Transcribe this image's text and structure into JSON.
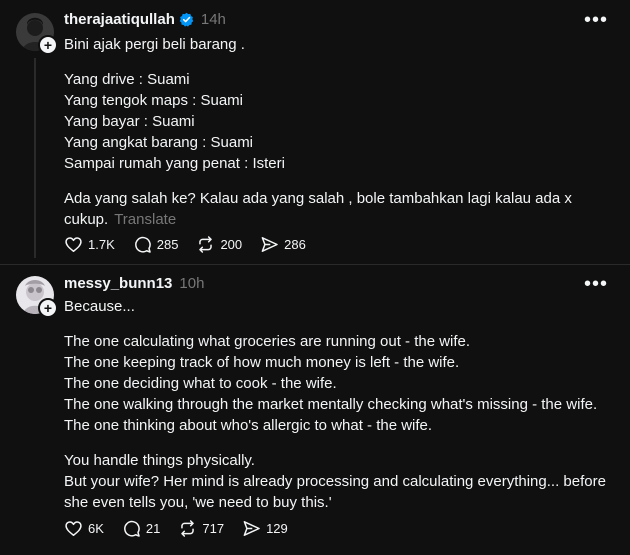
{
  "posts": [
    {
      "username": "therajaatiqullah",
      "verified": true,
      "time": "14h",
      "lines": {
        "l1": "Bini ajak pergi beli barang .",
        "l2": "Yang drive : Suami",
        "l3": "Yang tengok maps : Suami",
        "l4": "Yang bayar : Suami",
        "l5": "Yang angkat barang : Suami",
        "l6": "Sampai rumah yang penat : Isteri",
        "l7": "Ada yang salah ke? Kalau ada yang salah , bole tambahkan lagi kalau ada x",
        "l8": "cukup."
      },
      "translate": "Translate",
      "likes": "1.7K",
      "comments": "285",
      "reposts": "200",
      "shares": "286"
    },
    {
      "username": "messy_bunn13",
      "time": "10h",
      "lines": {
        "l1": "Because...",
        "l2": "The one calculating what groceries are running out - the wife.",
        "l3": "The one keeping track of how much money is left - the wife.",
        "l4": "The one deciding what to cook - the wife.",
        "l5": "The one walking through the market mentally checking what's missing - the wife.",
        "l6": "The one thinking about who's allergic to what - the wife.",
        "l7": "You handle things physically.",
        "l8": "But your wife? Her mind is already processing and calculating everything... before",
        "l9": "she even tells you, 'we need to buy this.'"
      },
      "likes": "6K",
      "comments": "21",
      "reposts": "717",
      "shares": "129"
    }
  ],
  "icons": {
    "verified": "verified-badge-icon",
    "more": "more-options-icon",
    "like": "heart-icon",
    "comment": "comment-icon",
    "repost": "repost-icon",
    "share": "share-icon"
  },
  "colors": {
    "background": "#101010",
    "text": "#f3f5f7",
    "muted": "#777777",
    "verified": "#0095f6"
  }
}
